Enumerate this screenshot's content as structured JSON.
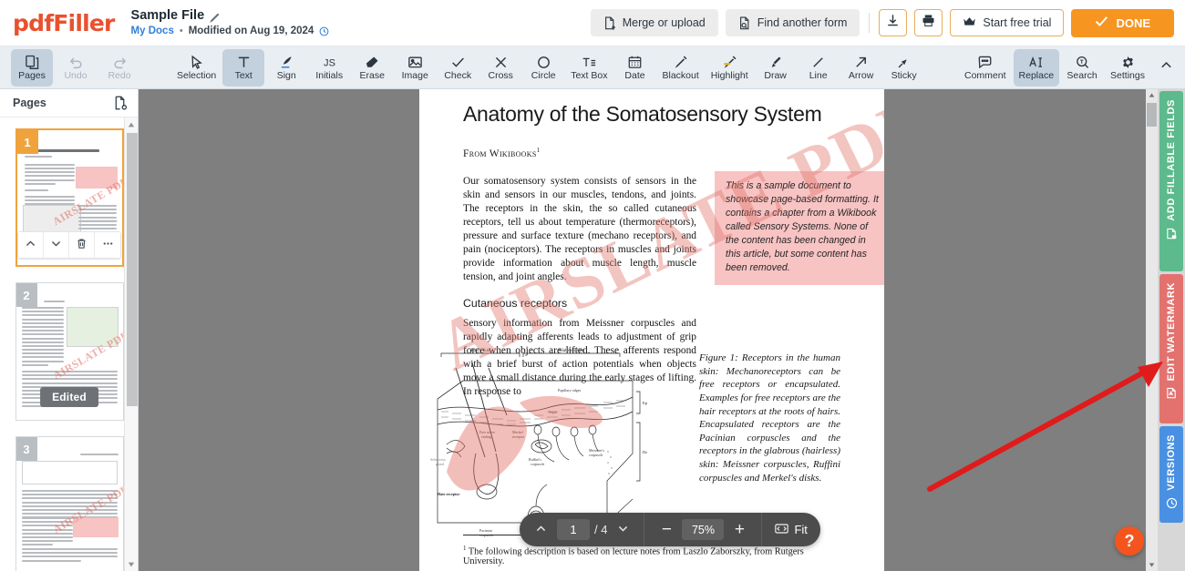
{
  "app": {
    "brand": "pdfFiller",
    "document_title": "Sample File",
    "breadcrumb_link": "My Docs",
    "breadcrumb_dot": "•",
    "modified_text": "Modified on Aug 19, 2024"
  },
  "header_actions": {
    "merge_or_upload": "Merge or upload",
    "find_another_form": "Find another form",
    "download_icon": "download-icon",
    "print_icon": "print-icon",
    "start_free_trial": "Start free trial",
    "done": "DONE",
    "accent_orange": "#f79521",
    "outline_orange": "#e8ae5a"
  },
  "toolbar": {
    "left": [
      {
        "label": "Pages",
        "icon": "pages-icon",
        "active": true,
        "disabled": false
      },
      {
        "label": "Undo",
        "icon": "undo-icon",
        "active": false,
        "disabled": true
      },
      {
        "label": "Redo",
        "icon": "redo-icon",
        "active": false,
        "disabled": true
      }
    ],
    "middle": [
      {
        "label": "Selection",
        "icon": "cursor-icon",
        "active": false
      },
      {
        "label": "Text",
        "icon": "text-icon",
        "active": true
      },
      {
        "label": "Sign",
        "icon": "sign-icon",
        "active": false
      },
      {
        "label": "Initials",
        "icon": "initials-icon",
        "active": false
      },
      {
        "label": "Erase",
        "icon": "eraser-icon",
        "active": false
      },
      {
        "label": "Image",
        "icon": "image-icon",
        "active": false
      },
      {
        "label": "Check",
        "icon": "check-icon",
        "active": false
      },
      {
        "label": "Cross",
        "icon": "cross-icon",
        "active": false
      },
      {
        "label": "Circle",
        "icon": "circle-icon",
        "active": false
      },
      {
        "label": "Text Box",
        "icon": "textbox-icon",
        "active": false
      },
      {
        "label": "Date",
        "icon": "calendar-icon",
        "active": false
      },
      {
        "label": "Blackout",
        "icon": "blackout-icon",
        "active": false
      },
      {
        "label": "Highlight",
        "icon": "highlight-icon",
        "active": false
      },
      {
        "label": "Draw",
        "icon": "brush-icon",
        "active": false
      },
      {
        "label": "Line",
        "icon": "line-icon",
        "active": false
      },
      {
        "label": "Arrow",
        "icon": "arrow-icon",
        "active": false
      },
      {
        "label": "Sticky",
        "icon": "pin-icon",
        "active": false
      }
    ],
    "right": [
      {
        "label": "Comment",
        "icon": "comment-icon",
        "active": false
      },
      {
        "label": "Replace",
        "icon": "replace-icon",
        "active": true
      },
      {
        "label": "Search",
        "icon": "search-icon",
        "active": false
      },
      {
        "label": "Settings",
        "icon": "gear-icon",
        "active": false
      }
    ],
    "collapse_icon": "chevron-up-icon"
  },
  "pages_panel": {
    "title": "Pages",
    "header_icon": "page-settings-icon",
    "thumbnails": [
      {
        "number": "1",
        "selected": true,
        "watermark": "AIRSLATE PDF",
        "badge": ""
      },
      {
        "number": "2",
        "selected": false,
        "watermark": "AIRSLATE PDF",
        "badge": "Edited"
      },
      {
        "number": "3",
        "selected": false,
        "watermark": "AIRSLATE PDF",
        "badge": ""
      }
    ],
    "thumb_actions": [
      {
        "name": "move-page-up",
        "icon": "chevron-up-icon"
      },
      {
        "name": "move-page-down",
        "icon": "chevron-down-icon"
      },
      {
        "name": "delete-page",
        "icon": "trash-icon"
      },
      {
        "name": "page-more-options",
        "icon": "ellipsis-icon"
      }
    ]
  },
  "document": {
    "heading": "Anatomy of the Somatosensory System",
    "source_line": "From Wikibooks",
    "source_sup": "1",
    "paragraph1": "Our somatosensory system consists of sensors in the skin and sensors in our muscles, tendons, and joints. The receptors in the skin, the so called cutaneous receptors, tell us about temperature (thermoreceptors), pressure and surface texture (mechano receptors), and pain (nociceptors). The receptors in muscles and joints provide information about muscle length, muscle tension, and joint angles.",
    "subheading": "Cutaneous receptors",
    "paragraph2": "Sensory information from Meissner corpuscles and rapidly adapting afferents leads to adjustment of grip force when objects are lifted. These afferents respond with a brief burst of action potentials when objects move a small distance during the early stages of lifting. In response to",
    "note": "This is a sample document to showcase page-based formatting. It contains a chapter from a Wikibook called Sensory Systems. None of the content has been changed in this article, but some content has been removed.",
    "figure_caption": "Figure 1: Receptors in the human skin: Mechanoreceptors can be free receptors or encapsulated. Examples for free receptors are the hair receptors at the roots of hairs. Encapsulated receptors are the Pacinian corpuscles and the receptors in the glabrous (hairless) skin: Meissner corpuscles, Ruffini corpuscles and Merkel's disks.",
    "footnote_sup": "1",
    "footnote": "The following description is based on lecture notes from Laszlo Zaborszky, from Rutgers University.",
    "watermark": "AIRSLATE PDF",
    "figure_labels": {
      "hairy_skin": "Hairy skin",
      "glabrous_skin": "Glabrous skin",
      "papillary_ridges": "Papillary ridges",
      "epidermis": "Epidermis",
      "dermis": "Dermis",
      "septa": "Septa",
      "meissner_corpuscle": "Meissner's corpuscle",
      "merkel_receptor": "Merkel receptor",
      "free_nerve_ending": "Free nerve ending",
      "sebaceous_gland": "Sebaceous gland",
      "hair_receptor": "Hair receptor",
      "ruffini_corpuscle": "Ruffini's corpuscle",
      "pacinian_corpuscle": "Pacinian corpuscle"
    }
  },
  "page_nav": {
    "prev_icon": "chevron-up-icon",
    "current_page": "1",
    "total_pages": "/ 4",
    "dropdown_icon": "chevron-down-icon",
    "zoom_out": "−",
    "zoom_value": "75%",
    "zoom_in": "+",
    "fit_label": "Fit",
    "fit_icon": "fit-width-icon"
  },
  "right_rail": {
    "tabs": [
      {
        "label": "ADD FILLABLE FIELDS",
        "icon": "fillable-fields-icon",
        "color": "#5cba8c"
      },
      {
        "label": "EDIT WATERMARK",
        "icon": "watermark-icon",
        "color": "#e3726e"
      },
      {
        "label": "VERSIONS",
        "icon": "history-clock-icon",
        "color": "#4a90e2"
      }
    ]
  },
  "help": {
    "label": "?",
    "color": "#f4551f"
  },
  "annotation": {
    "type": "red-arrow",
    "color": "#e01b1b",
    "points_to": "EDIT WATERMARK"
  }
}
